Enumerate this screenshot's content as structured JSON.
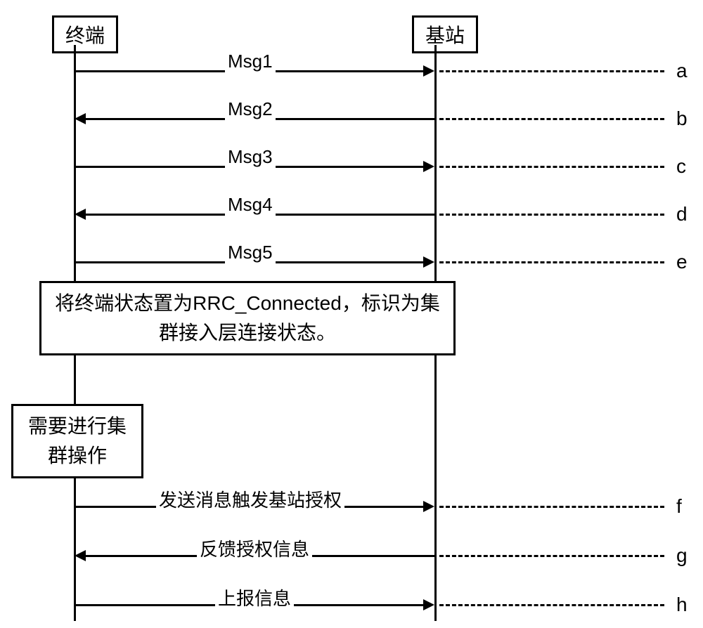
{
  "actors": {
    "left": "终端",
    "right": "基站"
  },
  "messages": [
    {
      "label": "Msg1",
      "direction": "right",
      "step": "a"
    },
    {
      "label": "Msg2",
      "direction": "left",
      "step": "b"
    },
    {
      "label": "Msg3",
      "direction": "right",
      "step": "c"
    },
    {
      "label": "Msg4",
      "direction": "left",
      "step": "d"
    },
    {
      "label": "Msg5",
      "direction": "right",
      "step": "e"
    },
    {
      "label": "发送消息触发基站授权",
      "direction": "right",
      "step": "f"
    },
    {
      "label": "反馈授权信息",
      "direction": "left",
      "step": "g"
    },
    {
      "label": "上报信息",
      "direction": "right",
      "step": "h"
    }
  ],
  "notes": {
    "middle": "将终端状态置为RRC_Connected，标识为集群接入层连接状态。",
    "side": "需要进行集群操作"
  }
}
